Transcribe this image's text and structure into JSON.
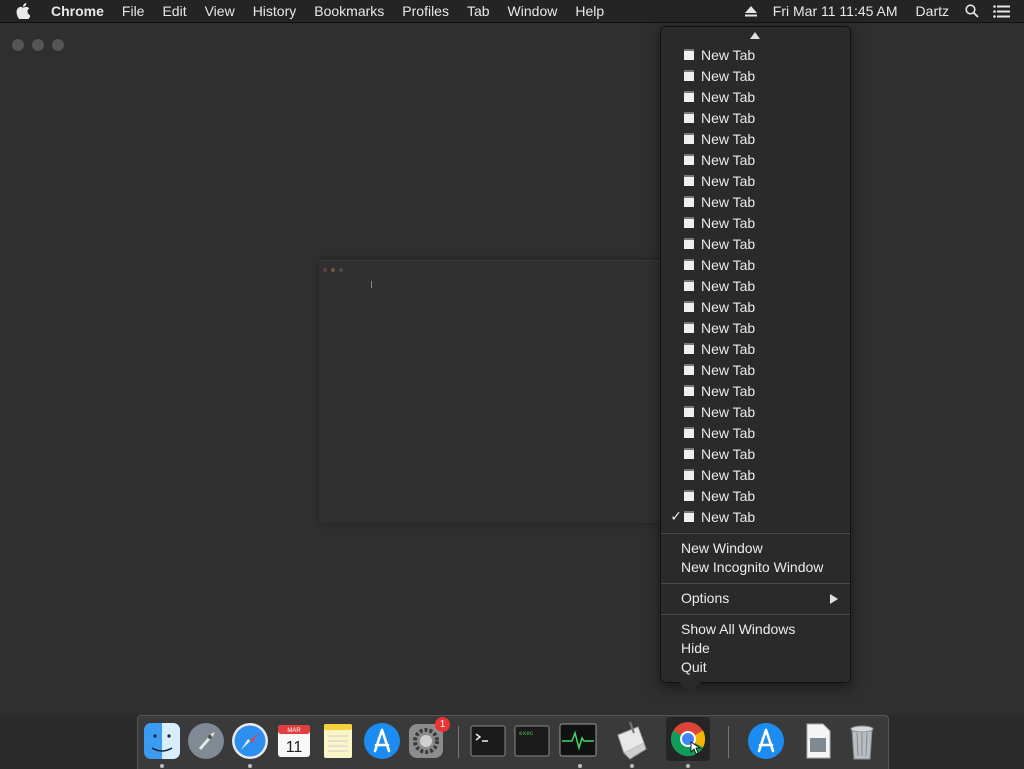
{
  "menubar": {
    "app_name": "Chrome",
    "items": [
      "File",
      "Edit",
      "View",
      "History",
      "Bookmarks",
      "Profiles",
      "Tab",
      "Window",
      "Help"
    ],
    "clock": "Fri Mar 11  11:45 AM",
    "user": "Dartz",
    "icons": [
      "apple-icon",
      "eject-icon",
      "spotlight-search-icon",
      "notification-center-icon"
    ]
  },
  "dock_menu": {
    "tabs": [
      {
        "label": "New Tab",
        "checked": false
      },
      {
        "label": "New Tab",
        "checked": false
      },
      {
        "label": "New Tab",
        "checked": false
      },
      {
        "label": "New Tab",
        "checked": false
      },
      {
        "label": "New Tab",
        "checked": false
      },
      {
        "label": "New Tab",
        "checked": false
      },
      {
        "label": "New Tab",
        "checked": false
      },
      {
        "label": "New Tab",
        "checked": false
      },
      {
        "label": "New Tab",
        "checked": false
      },
      {
        "label": "New Tab",
        "checked": false
      },
      {
        "label": "New Tab",
        "checked": false
      },
      {
        "label": "New Tab",
        "checked": false
      },
      {
        "label": "New Tab",
        "checked": false
      },
      {
        "label": "New Tab",
        "checked": false
      },
      {
        "label": "New Tab",
        "checked": false
      },
      {
        "label": "New Tab",
        "checked": false
      },
      {
        "label": "New Tab",
        "checked": false
      },
      {
        "label": "New Tab",
        "checked": false
      },
      {
        "label": "New Tab",
        "checked": false
      },
      {
        "label": "New Tab",
        "checked": false
      },
      {
        "label": "New Tab",
        "checked": false
      },
      {
        "label": "New Tab",
        "checked": false
      },
      {
        "label": "New Tab",
        "checked": true
      }
    ],
    "check_mark": "✓",
    "new_window": "New Window",
    "new_incognito": "New Incognito Window",
    "options": "Options",
    "show_all": "Show All Windows",
    "hide": "Hide",
    "quit": "Quit"
  },
  "dock": {
    "calendar_month": "MAR",
    "calendar_day": "11",
    "preferences_badge": "1",
    "exec_label": "exec",
    "apps": [
      "Finder",
      "Launchpad",
      "Safari",
      "Calendar",
      "Notes",
      "App Store",
      "System Preferences",
      "Terminal",
      "exec",
      "Activity Monitor",
      "Script Editor",
      "Chrome",
      "App Store Downloads",
      "Preview Document",
      "Trash"
    ]
  }
}
